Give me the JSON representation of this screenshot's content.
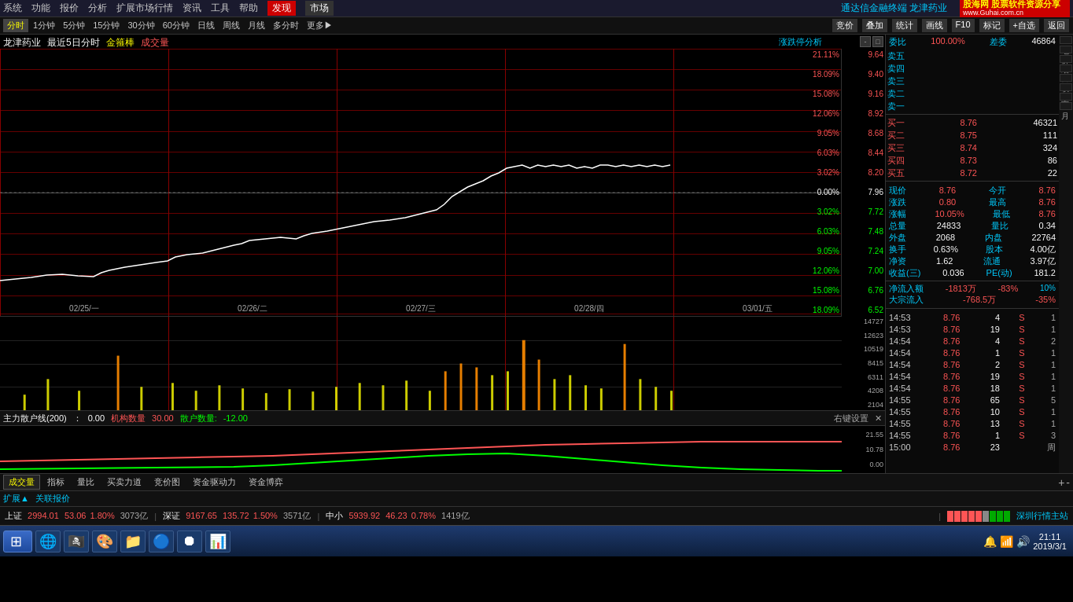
{
  "topMenu": {
    "items": [
      "系统",
      "功能",
      "报价",
      "分析",
      "扩展市场行情",
      "资讯",
      "工具",
      "帮助",
      "发现",
      "市场"
    ],
    "activeItem": "发现",
    "marketItem": "市场",
    "rightInfo": "通达信金融终端 龙津药业"
  },
  "toolbar": {
    "items": [
      "分时",
      "1分钟",
      "5分钟",
      "15分钟",
      "30分钟",
      "60分钟",
      "日线",
      "周线",
      "月线",
      "多分时",
      "更多▶"
    ],
    "activeItem": "分时",
    "rightBtns": [
      "竞价",
      "叠加",
      "统计",
      "画线",
      "F10",
      "标记",
      "+自选",
      "返回"
    ]
  },
  "chartTitle": {
    "stockName": "龙津药业",
    "period": "最近5日分时",
    "indicator": "金箍棒",
    "indicator2": "成交量"
  },
  "priceAxis": {
    "labels": [
      "9.64",
      "9.40",
      "9.16",
      "8.92",
      "8.68",
      "8.44",
      "8.20",
      "7.96",
      "7.72",
      "7.48",
      "7.24",
      "7.00",
      "6.76",
      "6.52"
    ]
  },
  "pctAxis": {
    "labels": [
      "21.11%",
      "18.09%",
      "15.08%",
      "12.06%",
      "9.05%",
      "6.03%",
      "3.02%",
      "0.00%",
      "3.02%",
      "6.03%",
      "9.05%",
      "12.06%",
      "15.08%",
      "18.09%"
    ]
  },
  "volumeAxis": {
    "labels": [
      "14727",
      "12623",
      "10519",
      "8415",
      "6311",
      "4208",
      "2104"
    ]
  },
  "dateLabels": [
    "02/25/一",
    "02/26/二",
    "02/27/三",
    "02/28/四",
    "03/01/五"
  ],
  "orderBook": {
    "header": {
      "label": "委比",
      "value": "100.00%",
      "diff": "差委",
      "vol": "46864"
    },
    "asks": [
      {
        "label": "卖五",
        "price": "",
        "vol": ""
      },
      {
        "label": "卖四",
        "price": "",
        "vol": ""
      },
      {
        "label": "卖三",
        "price": "",
        "vol": ""
      },
      {
        "label": "卖二",
        "price": "",
        "vol": ""
      },
      {
        "label": "卖一",
        "price": "",
        "vol": ""
      }
    ],
    "bids": [
      {
        "label": "买一",
        "price": "8.76",
        "vol": "46321"
      },
      {
        "label": "买二",
        "price": "8.75",
        "vol": "111"
      },
      {
        "label": "买三",
        "price": "8.74",
        "vol": "324"
      },
      {
        "label": "买四",
        "price": "8.73",
        "vol": "86"
      },
      {
        "label": "买五",
        "price": "8.72",
        "vol": "22"
      }
    ]
  },
  "stockInfo": {
    "currentPrice": {
      "label": "现价",
      "value": "8.76",
      "label2": "今开",
      "value2": "8.76"
    },
    "change": {
      "label": "涨跌",
      "value": "0.80",
      "label2": "最高",
      "value2": "8.76"
    },
    "changePct": {
      "label": "涨幅",
      "value": "10.05%",
      "label2": "最低",
      "value2": "8.76"
    },
    "totalVol": {
      "label": "总量",
      "value": "24833",
      "label2": "量比",
      "value2": "0.34"
    },
    "outerVol": {
      "label": "外盘",
      "value": "2068",
      "label2": "内盘",
      "value2": "22764"
    },
    "turnover": {
      "label": "换手",
      "value": "0.63%",
      "label2": "股本",
      "value2": "4.00亿"
    },
    "netFlow": {
      "label": "净资",
      "value": "1.62",
      "label2": "流通",
      "value2": "3.97亿"
    },
    "earnings": {
      "label": "收益(三)",
      "value": "0.036",
      "label2": "PE(动)",
      "value2": "181.2"
    }
  },
  "netFlow": {
    "inflow": {
      "label": "净流入额",
      "value": "-1813万",
      "pct": "-83%",
      "extra": "10%"
    },
    "blockTrade": {
      "label": "大宗流入",
      "value": "-768.5万",
      "pct": "-35%"
    }
  },
  "trades": [
    {
      "time": "14:53",
      "price": "8.76",
      "vol": "4",
      "type": "S",
      "num": "1"
    },
    {
      "time": "14:53",
      "price": "8.76",
      "vol": "19",
      "type": "S",
      "num": "1"
    },
    {
      "time": "14:54",
      "price": "8.76",
      "vol": "4",
      "type": "S",
      "num": "2"
    },
    {
      "time": "14:54",
      "price": "8.76",
      "vol": "1",
      "type": "S",
      "num": "1"
    },
    {
      "time": "14:54",
      "price": "8.76",
      "vol": "2",
      "type": "S",
      "num": "1"
    },
    {
      "time": "14:54",
      "price": "8.76",
      "vol": "19",
      "type": "S",
      "num": "1"
    },
    {
      "time": "14:54",
      "price": "8.76",
      "vol": "18",
      "type": "S",
      "num": "1"
    },
    {
      "time": "14:55",
      "price": "8.76",
      "vol": "65",
      "type": "S",
      "num": "5"
    },
    {
      "time": "14:55",
      "price": "8.76",
      "vol": "10",
      "type": "S",
      "num": "1"
    },
    {
      "time": "14:55",
      "price": "8.76",
      "vol": "13",
      "type": "S",
      "num": "1"
    },
    {
      "time": "14:55",
      "price": "8.76",
      "vol": "1",
      "type": "S",
      "num": "3"
    },
    {
      "time": "15:00",
      "price": "8.76",
      "vol": "23",
      "type": "",
      "num": "周"
    }
  ],
  "indicatorBar": {
    "label": "主力散户线(200)",
    "val1": "0.00",
    "label2": "机构数量",
    "val2": "30.00",
    "label3": "散户数量:",
    "val3": "-12.00",
    "rightBtn": "右键设置"
  },
  "bottomTabs": [
    "成交量",
    "指标",
    "量比",
    "买卖力道",
    "竞价图",
    "资金驱动力",
    "资金博弈"
  ],
  "expandSection": [
    "扩展▲",
    "关联报价"
  ],
  "statusBar": {
    "items": [
      {
        "label": "上证",
        "value": "2994.01",
        "change": "53.06",
        "changePct": "1.80%",
        "vol": "3073亿"
      },
      {
        "label": "深证",
        "value": "9167.65",
        "change": "135.72",
        "changePct": "1.50%",
        "vol": "3571亿"
      },
      {
        "label": "中小",
        "value": "5939.92",
        "change": "46.23",
        "changePct": "0.78%",
        "vol": "1419亿"
      },
      {
        "label": "深圳行情主站"
      }
    ]
  },
  "rightSideTabs": [
    "笔",
    "价",
    "细",
    "日",
    "联",
    "主",
    "量",
    "月"
  ],
  "analysisBtn": "涨跌停分析",
  "taskbar": {
    "time": "21:11",
    "date": "2019/3/1"
  },
  "guhai": {
    "line1": "股海网 股票软件资源分享",
    "line2": "www.Guhai.com.cn"
  }
}
